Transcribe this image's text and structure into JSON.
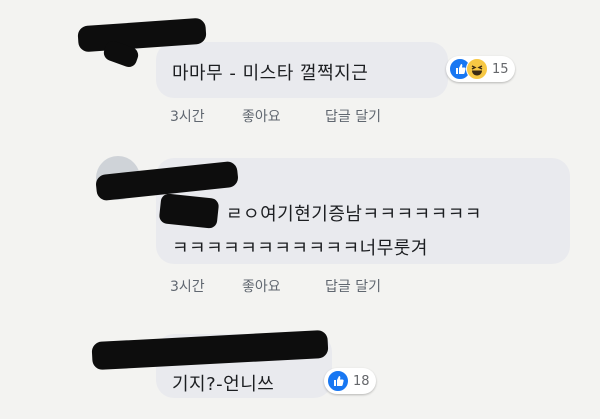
{
  "comments": [
    {
      "text": "마마무 - 미스타 껄쩍지근",
      "reactions": {
        "icons": [
          "like-icon",
          "haha-icon"
        ],
        "count": "15"
      },
      "actions": {
        "time": "3시간",
        "like": "좋아요",
        "reply": "답글 달기"
      }
    },
    {
      "lines": [
        "ㄹㅇ여기현기증남ㅋㅋㅋㅋㅋㅋㅋ",
        "ㅋㅋㅋㅋㅋㅋㅋㅋㅋㅋㅋ너무룻겨"
      ],
      "actions": {
        "time": "3시간",
        "like": "좋아요",
        "reply": "답글 달기"
      }
    },
    {
      "text": "기지?-언니쓰",
      "reactions": {
        "icons": [
          "like-icon"
        ],
        "count": "18"
      }
    }
  ],
  "colors": {
    "like_blue": "#1877f2",
    "haha_yellow": "#f7c844",
    "bubble": "#e9eaee"
  }
}
